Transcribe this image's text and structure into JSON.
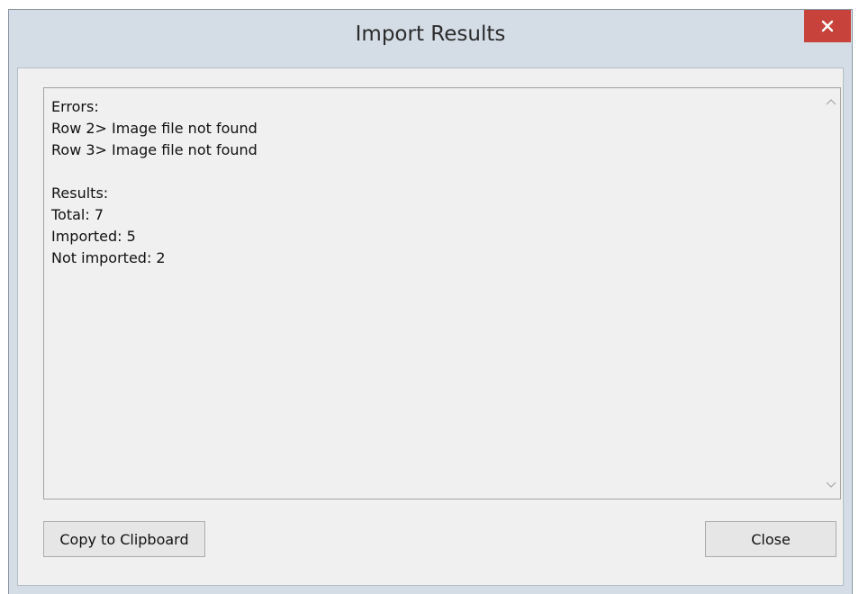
{
  "window": {
    "title": "Import Results",
    "close_icon": "close-x-icon",
    "close_color": "#c7423a"
  },
  "results_text": {
    "lines": [
      "Errors:",
      "Row 2> Image file not found",
      "Row 3> Image file not found",
      "",
      "Results:",
      "Total: 7",
      "Imported: 5",
      "Not imported: 2"
    ],
    "scroll_up_icon": "chevron-up-icon",
    "scroll_down_icon": "chevron-down-icon"
  },
  "buttons": {
    "copy_label": "Copy to Clipboard",
    "close_label": "Close"
  }
}
